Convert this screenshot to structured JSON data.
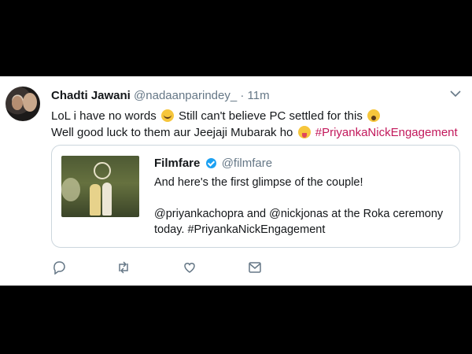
{
  "tweet": {
    "author_name": "Chadti Jawani",
    "author_handle": "@nadaanparindey_",
    "separator": "·",
    "time": "11m",
    "lines": [
      {
        "before": "LoL i have no words",
        "after": "Still can't believe PC settled for this"
      },
      {
        "before": "Well good luck to them aur Jeejaji Mubarak ho",
        "hashtag": "#PriyankaNickEngagement"
      }
    ],
    "emojis": [
      "crying-laughing-emoji",
      "astonished-emoji",
      "tongue-out-emoji"
    ]
  },
  "quoted": {
    "author_name": "Filmfare",
    "author_handle": "@filmfare",
    "line1": "And here's the first glimpse of the couple!",
    "line2": "@priyankachopra and @nickjonas at the Roka ceremony",
    "line3": "today. #PriyankaNickEngagement"
  },
  "actions": [
    "reply-icon",
    "retweet-icon",
    "like-icon",
    "message-icon"
  ],
  "colors": {
    "hashtag": "#c2185b",
    "verified": "#1da1f2",
    "muted": "#657786",
    "border": "#ccd6dd"
  }
}
